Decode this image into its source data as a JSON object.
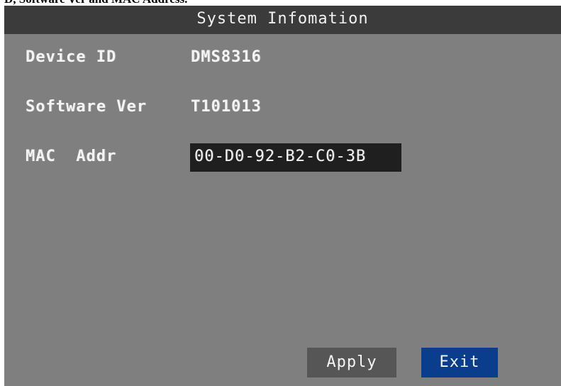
{
  "caption": "D, Software Ver and MAC Address.",
  "window": {
    "title": "System Infomation"
  },
  "fields": [
    {
      "label": "Device ID",
      "value": "DMS8316"
    },
    {
      "label": "Software Ver",
      "value": "T101013"
    },
    {
      "label": "MAC  Addr",
      "value": "00-D0-92-B2-C0-3B"
    }
  ],
  "buttons": {
    "apply_label": "Apply",
    "exit_label": "Exit"
  },
  "colors": {
    "panel_bg": "#7f7f7f",
    "title_bg": "#3b3b3b",
    "selected_field_bg": "#1f1f1f",
    "apply_bg": "#565656",
    "exit_bg": "#0a3e8c"
  }
}
